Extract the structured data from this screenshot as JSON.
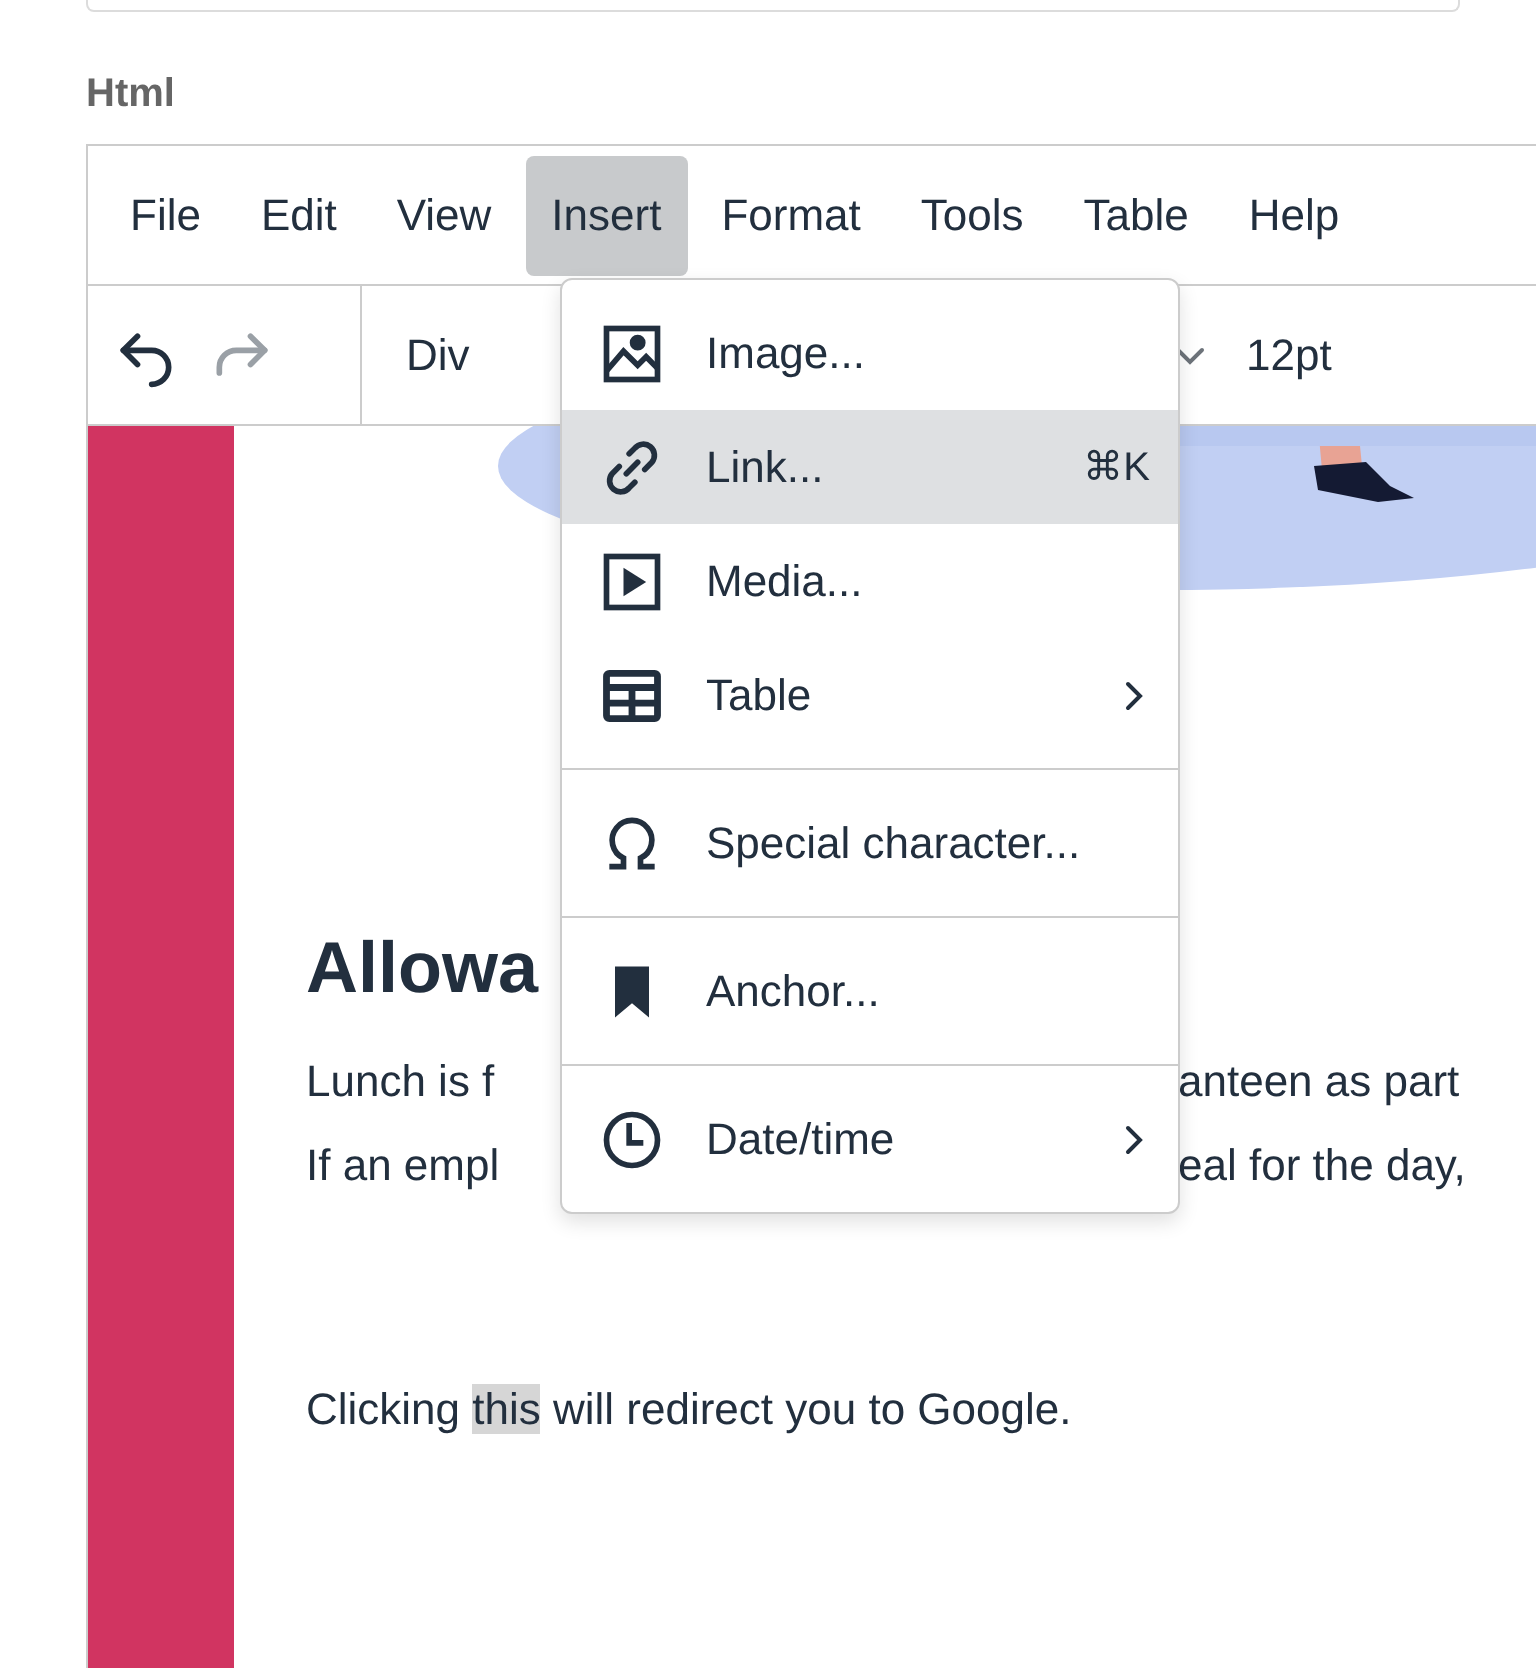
{
  "field_label": "Html",
  "menubar": [
    {
      "label": "File",
      "selected": false
    },
    {
      "label": "Edit",
      "selected": false
    },
    {
      "label": "View",
      "selected": false
    },
    {
      "label": "Insert",
      "selected": true
    },
    {
      "label": "Format",
      "selected": false
    },
    {
      "label": "Tools",
      "selected": false
    },
    {
      "label": "Table",
      "selected": false
    },
    {
      "label": "Help",
      "selected": false
    }
  ],
  "toolbar": {
    "history": [
      {
        "disabled": false
      },
      {
        "disabled": true
      }
    ],
    "block_format": "Div",
    "font_size": "12pt"
  },
  "menu": {
    "groups": [
      [
        {
          "label": "Image...",
          "selected": false,
          "submenu": false
        },
        {
          "label": "Link...",
          "shortcut": "⌘K",
          "selected": true,
          "submenu": false
        },
        {
          "label": "Media...",
          "selected": false,
          "submenu": false
        },
        {
          "label": "Table",
          "selected": false,
          "submenu": true
        }
      ],
      [
        {
          "label": "Special character...",
          "selected": false,
          "submenu": false
        }
      ],
      [
        {
          "label": "Anchor...",
          "selected": false,
          "submenu": false
        }
      ],
      [
        {
          "label": "Date/time",
          "selected": false,
          "submenu": true
        }
      ]
    ]
  },
  "content": {
    "heading": "Allowa",
    "lines": [
      {
        "left": "Lunch is f",
        "right": "anteen as part"
      },
      {
        "left": "If an empl",
        "right": "eal for the day,"
      }
    ],
    "sentence": {
      "before": "Clicking ",
      "selected_text": "this",
      "after": " will redirect you to Google."
    }
  }
}
